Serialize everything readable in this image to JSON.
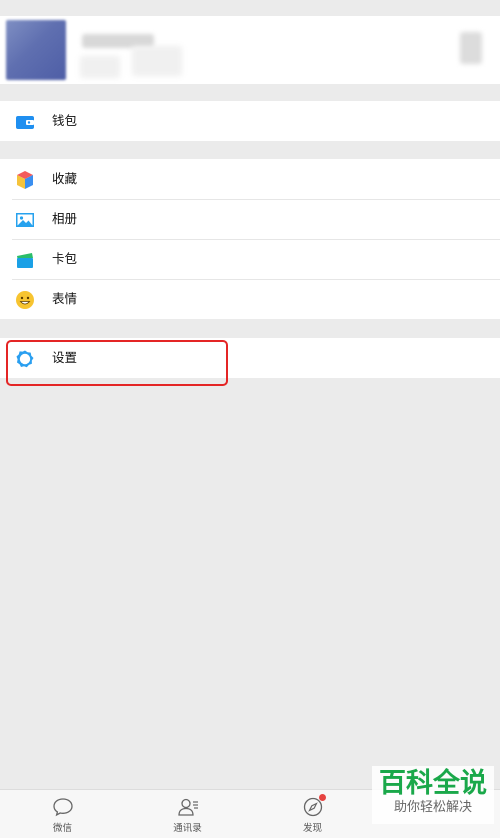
{
  "profile": {
    "name_hidden": true
  },
  "wallet_group": [
    {
      "id": "wallet",
      "label": "钱包",
      "icon": "wallet-icon"
    }
  ],
  "feature_group": [
    {
      "id": "favorites",
      "label": "收藏",
      "icon": "cube-icon"
    },
    {
      "id": "album",
      "label": "相册",
      "icon": "image-icon"
    },
    {
      "id": "cards",
      "label": "卡包",
      "icon": "card-icon"
    },
    {
      "id": "stickers",
      "label": "表情",
      "icon": "smiley-icon"
    }
  ],
  "settings_group": [
    {
      "id": "settings",
      "label": "设置",
      "icon": "gear-icon"
    }
  ],
  "tabs": [
    {
      "id": "chats",
      "label": "微信",
      "icon": "chat-bubble-icon"
    },
    {
      "id": "contacts",
      "label": "通讯录",
      "icon": "contacts-icon"
    },
    {
      "id": "discover",
      "label": "发现",
      "icon": "compass-icon",
      "badge": true
    },
    {
      "id": "me",
      "label": "",
      "icon": "person-icon"
    }
  ],
  "watermark": {
    "main": "百科全说",
    "sub": "助你轻松解决"
  },
  "colors": {
    "wallet_blue": "#1f8ff0",
    "gear_blue": "#2a9ff0",
    "highlight_red": "#e42525",
    "watermark_green": "#1aa84a",
    "badge_red": "#e64340"
  }
}
